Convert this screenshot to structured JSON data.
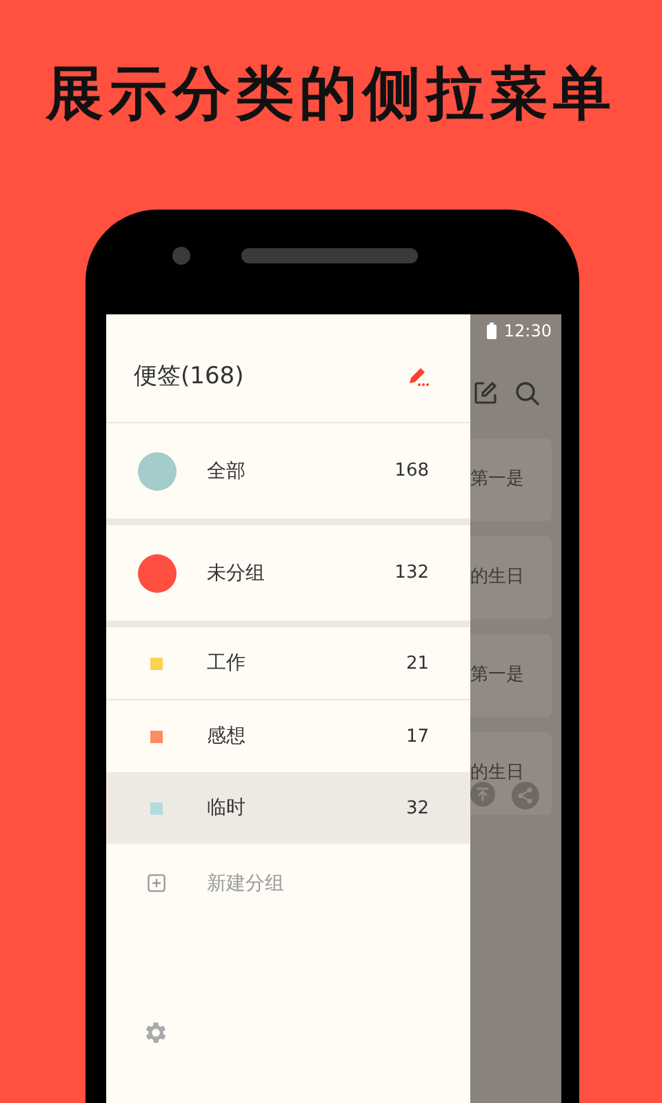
{
  "headline": "展示分类的侧拉菜单",
  "status_bar": {
    "time": "12:30"
  },
  "background_notes": [
    {
      "text": "第一是",
      "has_actions": false
    },
    {
      "text": "的生日",
      "has_actions": false
    },
    {
      "text": "第一是",
      "has_actions": false
    },
    {
      "text": "的生日",
      "has_actions": true
    }
  ],
  "drawer": {
    "title": "便签(168)",
    "categories": [
      {
        "kind": "circle",
        "label": "全部",
        "count": "168",
        "color": "#a3cccb",
        "selected": false
      },
      {
        "kind": "circle",
        "label": "未分组",
        "count": "132",
        "color": "#ff4f40",
        "selected": false
      },
      {
        "kind": "square",
        "label": "工作",
        "count": "21",
        "color": "#fcd252",
        "selected": false
      },
      {
        "kind": "square",
        "label": "感想",
        "count": "17",
        "color": "#fe8b61",
        "selected": false
      },
      {
        "kind": "square",
        "label": "临时",
        "count": "32",
        "color": "#b2dcdc",
        "selected": true
      }
    ],
    "new_group": "新建分组"
  }
}
